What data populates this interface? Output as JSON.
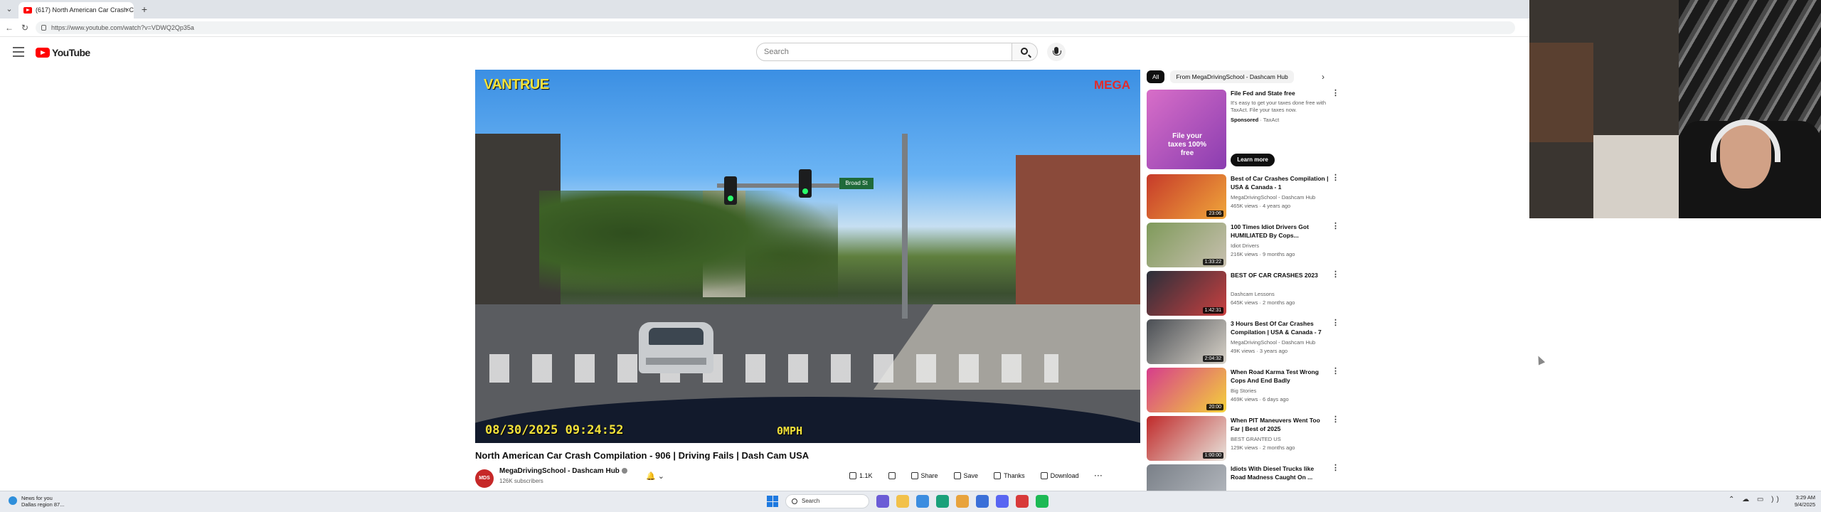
{
  "browser": {
    "tab_title": "(617) North American Car Crash C",
    "tab_close": "×",
    "new_tab": "+",
    "tab_list": "⌄",
    "back": "←",
    "reload": "↻",
    "url": "https://www.youtube.com/watch?v=VDWQ2Qp35a"
  },
  "youtube": {
    "logo_text": "YouTube",
    "search_placeholder": "Search",
    "player": {
      "watermark_left": "VANTRUE",
      "watermark_right": "MEGA",
      "timestamp": "08/30/2025  09:24:52",
      "speed": "0MPH",
      "street_sign": "Broad St"
    },
    "video": {
      "title": "North American Car Crash Compilation - 906 | Driving Fails | Dash Cam USA",
      "channel_avatar": "MDS",
      "channel_name": "MegaDrivingSchool - Dashcam Hub",
      "subscribers": "126K subscribers",
      "bell": "🔔 ⌄",
      "actions": {
        "like": "1.1K",
        "share": "Share",
        "save": "Save",
        "thanks": "Thanks",
        "download": "Download",
        "more": "···"
      }
    },
    "chips": [
      "All",
      "From MegaDrivingSchool - Dashcam Hub"
    ],
    "chip_next": "›",
    "ad": {
      "title": "File Fed and State free",
      "description": "It's easy to get your taxes done free with TaxAct. File your taxes now.",
      "sponsored_label": "Sponsored",
      "advertiser": "TaxAct",
      "thumb_text": "File your taxes 100% free",
      "cta": "Learn more"
    },
    "recommendations": [
      {
        "title": "Best of Car Crashes Compilation | USA & Canada - 1",
        "channel": "MegaDrivingSchool - Dashcam Hub",
        "meta": "465K views · 4 years ago",
        "duration": "23:06",
        "colors": [
          "#c63a2a",
          "#f0a63a"
        ]
      },
      {
        "title": "100 Times Idiot Drivers Got HUMILIATED By Cops...",
        "channel": "Idiot Drivers",
        "meta": "216K views · 9 months ago",
        "duration": "1:33:22",
        "colors": [
          "#7f9a5a",
          "#c8c0b0"
        ]
      },
      {
        "title": "BEST OF CAR CRASHES 2023",
        "channel": "Dashcam Lessons",
        "meta": "645K views · 2 months ago",
        "duration": "1:42:31",
        "colors": [
          "#2a2f3a",
          "#c94040"
        ]
      },
      {
        "title": "3 Hours Best Of Car Crashes Compilation | USA & Canada - 7",
        "channel": "MegaDrivingSchool - Dashcam Hub",
        "meta": "49K views · 3 years ago",
        "duration": "2:04:32",
        "colors": [
          "#4a4e54",
          "#d8d2c8"
        ]
      },
      {
        "title": "When Road Karma Test Wrong Cops And End Badly",
        "channel": "Big Stories",
        "meta": "469K views · 6 days ago",
        "duration": "20:00",
        "colors": [
          "#d63c8c",
          "#f4d23a"
        ]
      },
      {
        "title": "When PIT Maneuvers Went Too Far | Best of 2025",
        "channel": "BEST GRANTED US",
        "meta": "129K views · 2 months ago",
        "duration": "1:00:00",
        "colors": [
          "#c02a2a",
          "#e8e4dc"
        ]
      },
      {
        "title": "Idiots With Diesel Trucks like Road Madness Caught On ...",
        "channel": "",
        "meta": "",
        "duration": "",
        "colors": [
          "#7a8088",
          "#b8bcc2"
        ]
      }
    ]
  },
  "taskbar": {
    "weather_title": "News for you",
    "weather_sub": "Dallas region 87...",
    "search_placeholder": "Search",
    "tray": "⌃ ☁ ▭ ))",
    "time": "3:29 AM",
    "date": "9/4/2025",
    "pinned_icons": [
      {
        "name": "copilot-icon",
        "color": "#6b5cd6"
      },
      {
        "name": "file-explorer-icon",
        "color": "#f2c14a"
      },
      {
        "name": "photos-icon",
        "color": "#3c8de0"
      },
      {
        "name": "edge-icon",
        "color": "#1aa17a"
      },
      {
        "name": "chrome-icon",
        "color": "#e8a33c"
      },
      {
        "name": "store-icon",
        "color": "#3a6fd8"
      },
      {
        "name": "discord-icon",
        "color": "#5865f2"
      },
      {
        "name": "app-red-icon",
        "color": "#d83a3a"
      },
      {
        "name": "spotify-icon",
        "color": "#1db954"
      }
    ]
  }
}
